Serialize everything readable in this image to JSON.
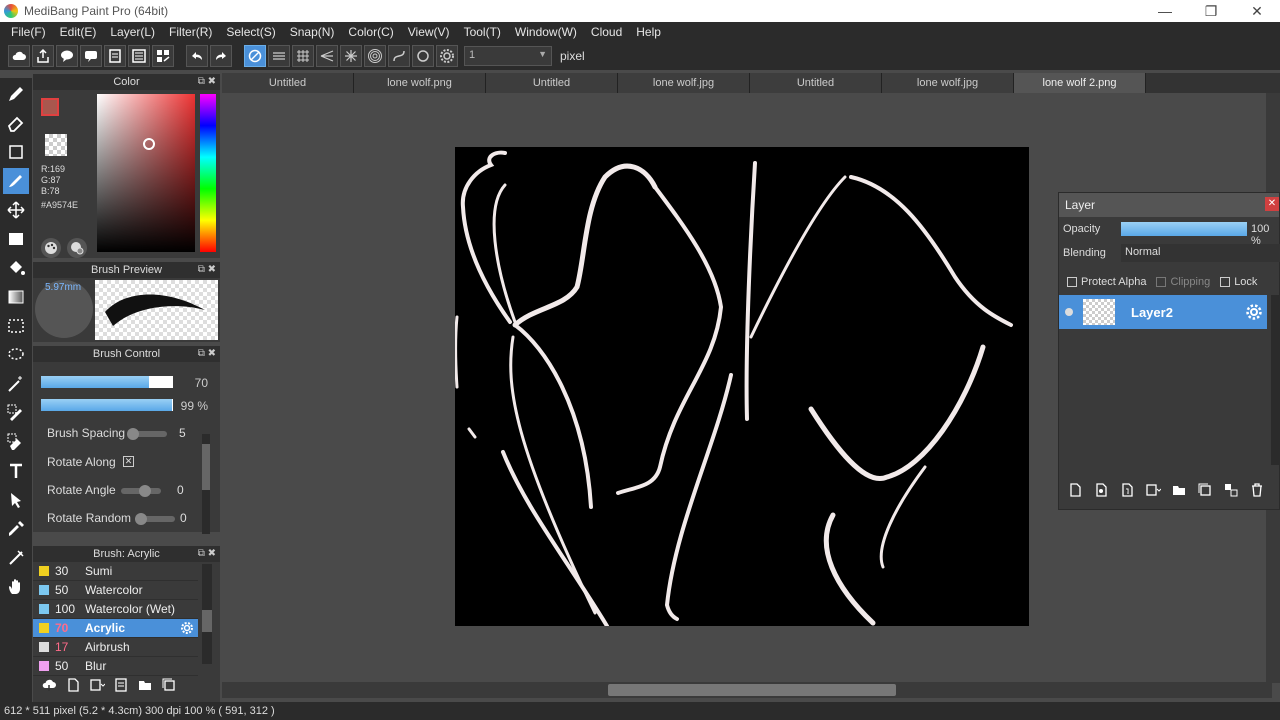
{
  "window": {
    "title": "MediBang Paint Pro (64bit)",
    "minimize_glyph": "—",
    "maximize_glyph": "❐",
    "close_glyph": "✕"
  },
  "menu": [
    "File(F)",
    "Edit(E)",
    "Layer(L)",
    "Filter(R)",
    "Select(S)",
    "Snap(N)",
    "Color(C)",
    "View(V)",
    "Tool(T)",
    "Window(W)",
    "Cloud",
    "Help"
  ],
  "toolbar": {
    "size_value": "1",
    "unit": "pixel"
  },
  "color_panel": {
    "title": "Color",
    "r": "R:169",
    "g": "G:87",
    "b": "B:78",
    "hex": "#A9574E",
    "fg_color": "#A9574E",
    "bg_color": "#F0D050"
  },
  "brush_preview": {
    "title": "Brush Preview",
    "size": "5.97mm"
  },
  "brush_control": {
    "title": "Brush Control",
    "size_value": "70",
    "opacity_value": "99 %",
    "size_fill": 0.82,
    "opacity_fill": 0.99,
    "spacing_label": "Brush Spacing",
    "spacing_value": "5",
    "rotate_along_label": "Rotate Along",
    "rotate_along_mark": "✕",
    "rotate_angle_label": "Rotate Angle",
    "rotate_angle_value": "0",
    "rotate_random_label": "Rotate Random",
    "rotate_random_value": "0"
  },
  "brush_list": {
    "title": "Brush: Acrylic",
    "items": [
      {
        "size": "30",
        "name": "Sumi",
        "color": "#f0d020"
      },
      {
        "size": "50",
        "name": "Watercolor",
        "color": "#7cc8f0"
      },
      {
        "size": "100",
        "name": "Watercolor (Wet)",
        "color": "#7cc8f0"
      },
      {
        "size": "70",
        "name": "Acrylic",
        "color": "#f0d020"
      },
      {
        "size": "17",
        "name": "Airbrush",
        "color": "#dddddd"
      },
      {
        "size": "50",
        "name": "Blur",
        "color": "#f0a0f0"
      }
    ]
  },
  "tabs": [
    "Untitled",
    "lone wolf.png",
    "Untitled",
    "lone wolf.jpg",
    "Untitled",
    "lone wolf.jpg",
    "lone wolf 2.png"
  ],
  "layer_panel": {
    "title": "Layer",
    "close_glyph": "✕",
    "opacity_label": "Opacity",
    "opacity_value": "100 %",
    "blending_label": "Blending",
    "blending_value": "Normal",
    "protect_alpha": "Protect Alpha",
    "clipping": "Clipping",
    "lock": "Lock",
    "layer_name": "Layer2"
  },
  "status": "612 * 511 pixel   (5.2 * 4.3cm)   300 dpi   100 %   ( 591, 312 )"
}
